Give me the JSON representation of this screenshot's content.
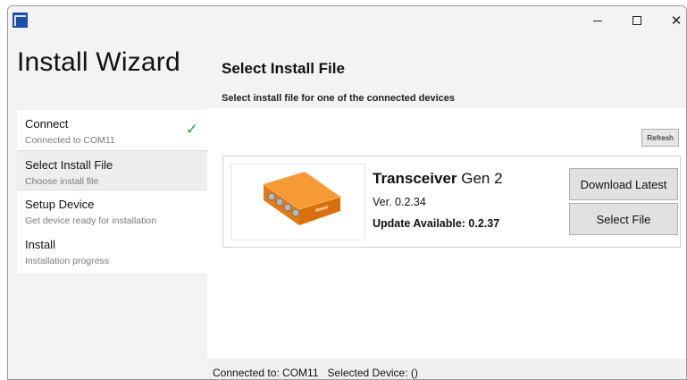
{
  "window": {
    "title_icon": "app-icon",
    "controls": {
      "minimize": "–",
      "maximize": "☐",
      "close": "✕"
    }
  },
  "sidebar": {
    "title": "Install Wizard",
    "steps": [
      {
        "title": "Connect",
        "subtitle": "Connected to COM11",
        "completed": true,
        "active": false
      },
      {
        "title": "Select Install File",
        "subtitle": "Choose install file",
        "completed": false,
        "active": true
      },
      {
        "title": "Setup Device",
        "subtitle": "Get device ready for installation",
        "completed": false,
        "active": false
      },
      {
        "title": "Install",
        "subtitle": "Installation progress",
        "completed": false,
        "active": false
      }
    ],
    "check_symbol": "✓"
  },
  "main": {
    "title": "Select Install File",
    "subtitle": "Select install file for one of the connected devices",
    "refresh_label": "Refresh",
    "devices": [
      {
        "name": "Transceiver",
        "generation": "Gen 2",
        "version": "Ver. 0.2.34",
        "update_status": "Update Available: 0.2.37",
        "download_label": "Download Latest",
        "select_label": "Select File",
        "image_icon": "transceiver-device-image"
      }
    ]
  },
  "statusbar": {
    "connection": "Connected to: COM11",
    "selected_device": "Selected Device: ()"
  },
  "colors": {
    "accent_check": "#2e9e3e",
    "device_orange": "#f08a24",
    "app_icon": "#1e4fa8"
  }
}
